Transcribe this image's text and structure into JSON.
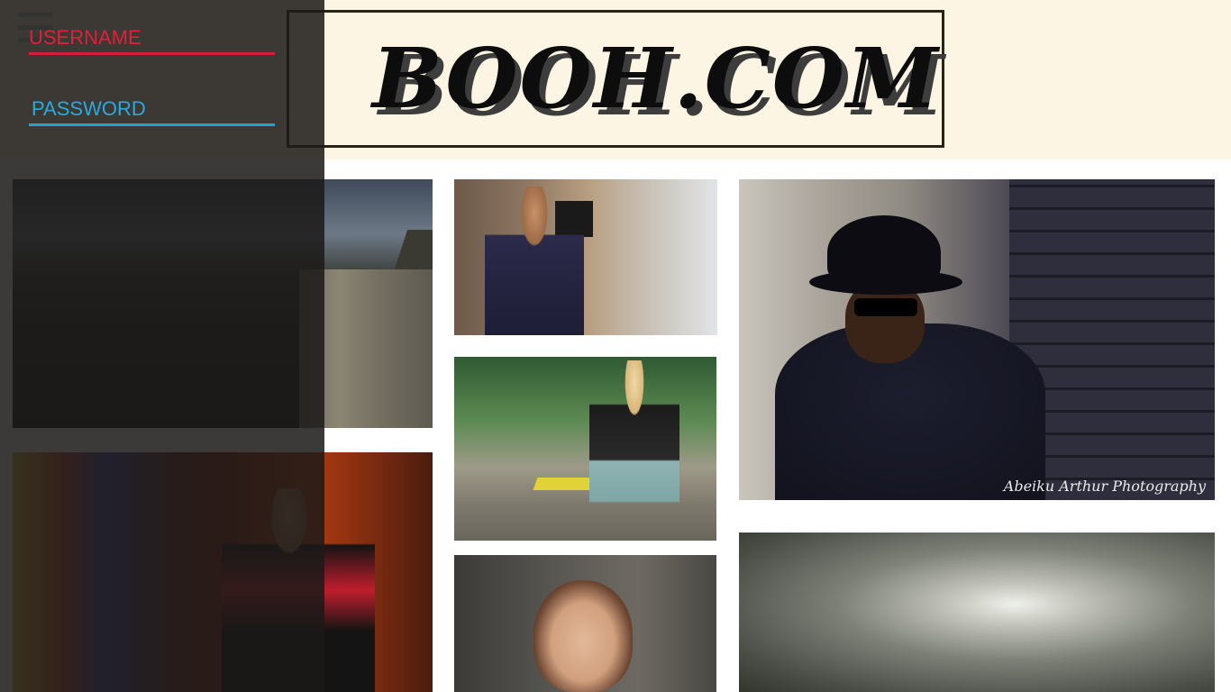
{
  "site": {
    "logo_text": "BOOH.COM"
  },
  "login": {
    "username_placeholder": "USERNAME",
    "password_placeholder": "PASSWORD"
  },
  "menu": {
    "icon": "hamburger-menu-icon"
  },
  "gallery": {
    "watermark": "Abeiku Arthur Photography"
  },
  "colors": {
    "header_bg": "#fdf5e3",
    "username_accent": "#e02038",
    "password_accent": "#29a9df",
    "overlay_bg": "rgba(28,26,24,0.86)"
  }
}
